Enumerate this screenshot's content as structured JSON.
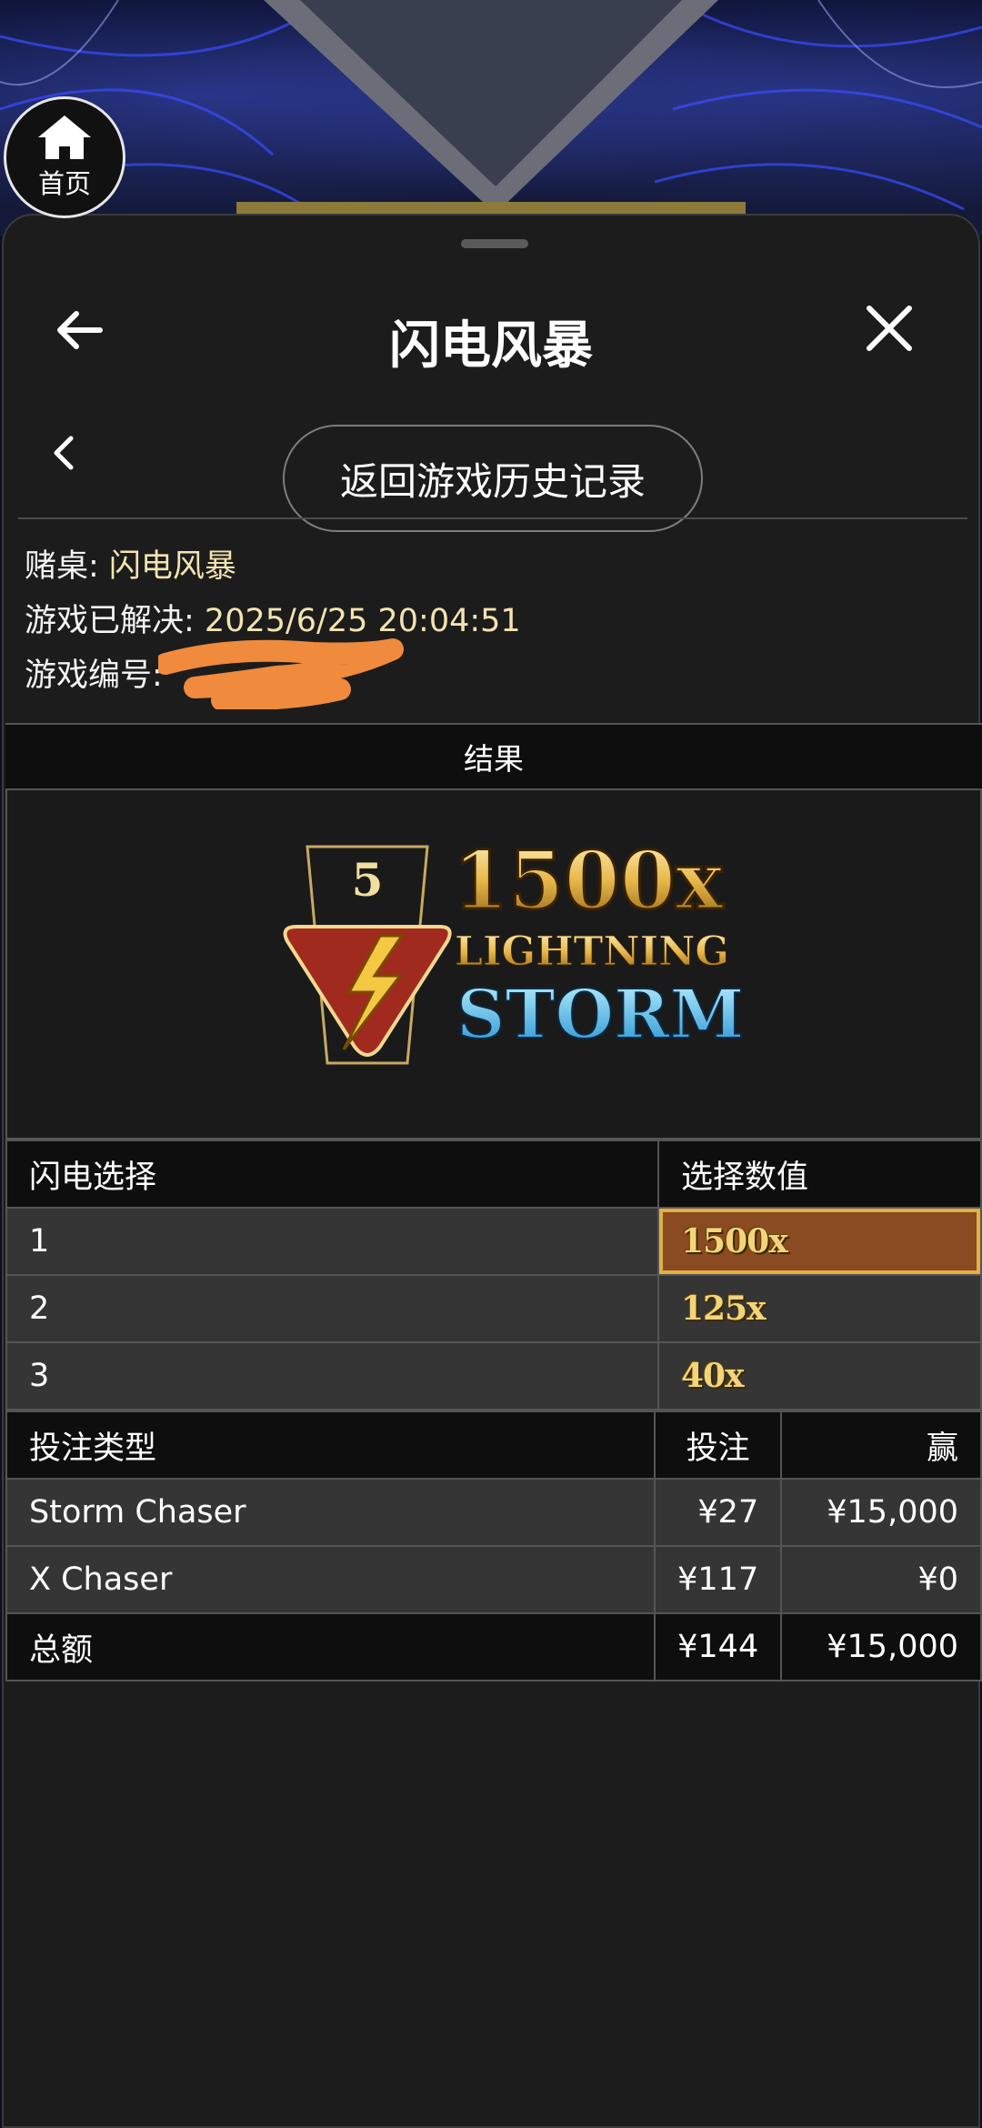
{
  "home": {
    "label": "首页"
  },
  "header": {
    "title": "闪电风暴"
  },
  "sub": {
    "history_button": "返回游戏历史记录"
  },
  "info": {
    "table_label": "赌桌: ",
    "table_value": "闪电风暴",
    "resolved_label": "游戏已解决: ",
    "resolved_value": "2025/6/25 20:04:51",
    "id_label": "游戏编号: "
  },
  "result": {
    "section_title": "结果",
    "logo": {
      "badge_number": "5",
      "multiplier": "1500x",
      "line1": "LIGHTNING",
      "line2": "STORM"
    }
  },
  "lightning": {
    "headers": [
      "闪电选择",
      "选择数值"
    ],
    "rows": [
      {
        "choice": "1",
        "value": "1500x",
        "highlighted": true
      },
      {
        "choice": "2",
        "value": "125x",
        "highlighted": false
      },
      {
        "choice": "3",
        "value": "40x",
        "highlighted": false
      }
    ]
  },
  "bets": {
    "headers": [
      "投注类型",
      "投注",
      "赢"
    ],
    "rows": [
      {
        "type": "Storm Chaser",
        "bet": "¥27",
        "win": "¥15,000"
      },
      {
        "type": "X Chaser",
        "bet": "¥117",
        "win": "¥0"
      }
    ],
    "total": {
      "label": "总额",
      "bet": "¥144",
      "win": "¥15,000"
    }
  },
  "colors": {
    "accent": "#f3e4b0",
    "highlight_fill": "#8a4a22",
    "highlight_border": "#e2b042"
  }
}
